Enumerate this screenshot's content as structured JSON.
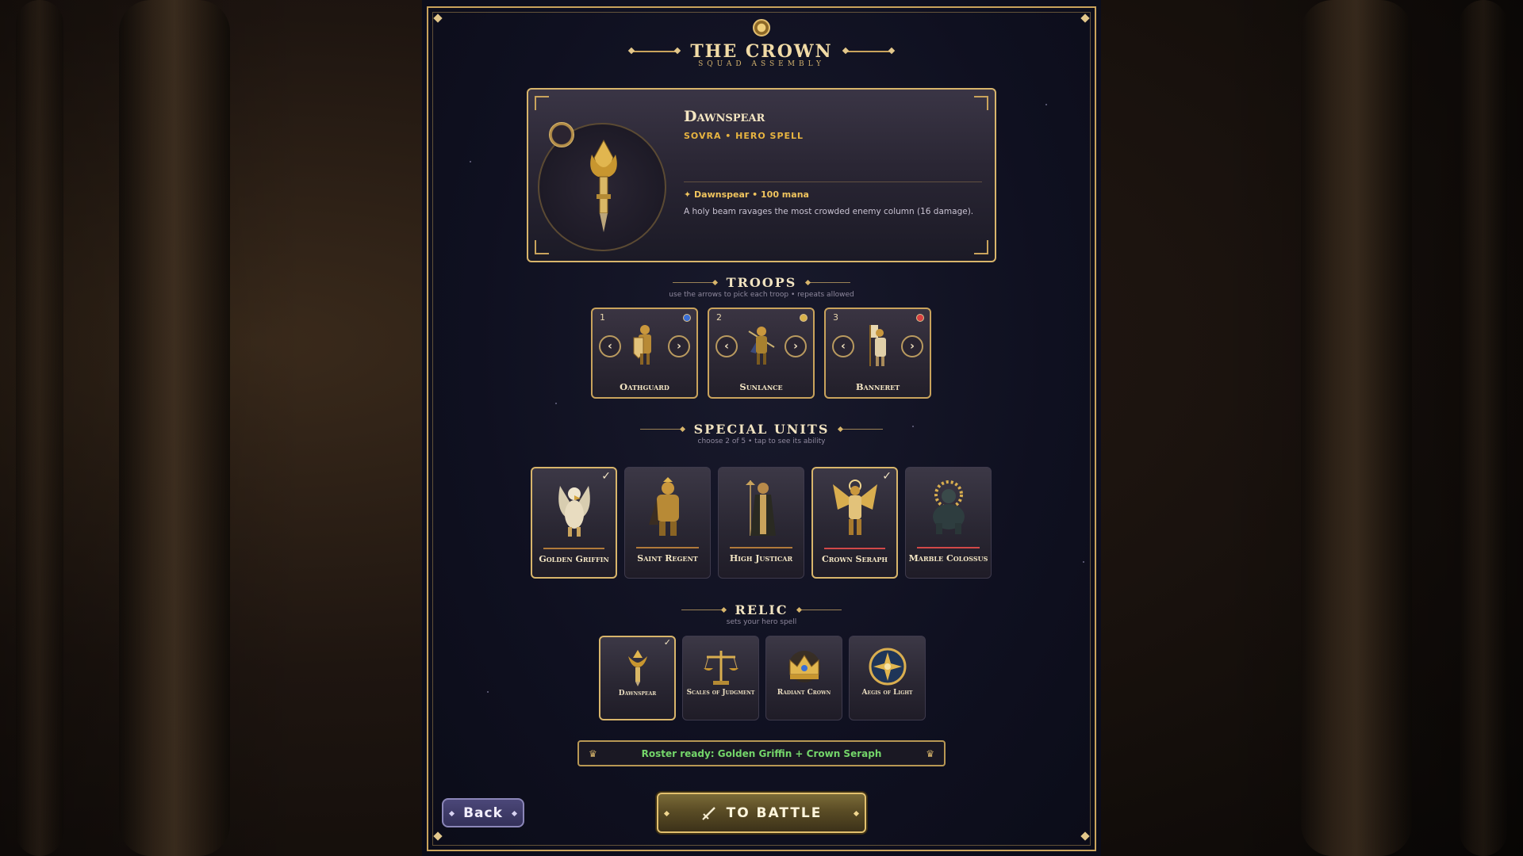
{
  "header": {
    "title": "THE CROWN",
    "subtitle": "SQUAD ASSEMBLY"
  },
  "hero": {
    "name": "Dawnspear",
    "subtitle": "SOVRA • HERO SPELL",
    "spell": "✦ Dawnspear • 100 mana",
    "description": "A holy beam ravages the most crowded enemy column (16 damage)."
  },
  "troops_section": {
    "title": "TROOPS",
    "hint": "use the arrows to pick each troop • repeats allowed",
    "items": [
      {
        "slot": "1",
        "name": "Oathguard",
        "dot_color": "#3b6fd6"
      },
      {
        "slot": "2",
        "name": "Sunlance",
        "dot_color": "#d8b14a"
      },
      {
        "slot": "3",
        "name": "Banneret",
        "dot_color": "#d84040"
      }
    ],
    "prev_symbol": "‹",
    "next_symbol": "›"
  },
  "special_section": {
    "title": "SPECIAL UNITS",
    "hint": "choose 2 of 5 • tap to see its ability",
    "items": [
      {
        "name": "Golden Griffin",
        "selected": true,
        "line_color": "#b07a3a"
      },
      {
        "name": "Saint Regent",
        "selected": false,
        "line_color": "#b07a3a"
      },
      {
        "name": "High Justicar",
        "selected": false,
        "line_color": "#b07a3a"
      },
      {
        "name": "Crown Seraph",
        "selected": true,
        "line_color": "#d14848"
      },
      {
        "name": "Marble Colossus",
        "selected": false,
        "line_color": "#d14848"
      }
    ],
    "check": "✓"
  },
  "relic_section": {
    "title": "RELIC",
    "hint": "sets your hero spell",
    "items": [
      {
        "name": "Dawnspear",
        "selected": true
      },
      {
        "name": "Scales of Judgment",
        "selected": false
      },
      {
        "name": "Radiant Crown",
        "selected": false
      },
      {
        "name": "Aegis of Light",
        "selected": false
      }
    ]
  },
  "status": {
    "text": "Roster ready: Golden Griffin + Crown Seraph",
    "icon": "♛"
  },
  "buttons": {
    "back": "Back",
    "battle": "TO BATTLE",
    "battle_icon": "sword-icon"
  },
  "colors": {
    "gold": "#c9a35c",
    "accent": "#e8b440",
    "ready": "#74d66a"
  }
}
